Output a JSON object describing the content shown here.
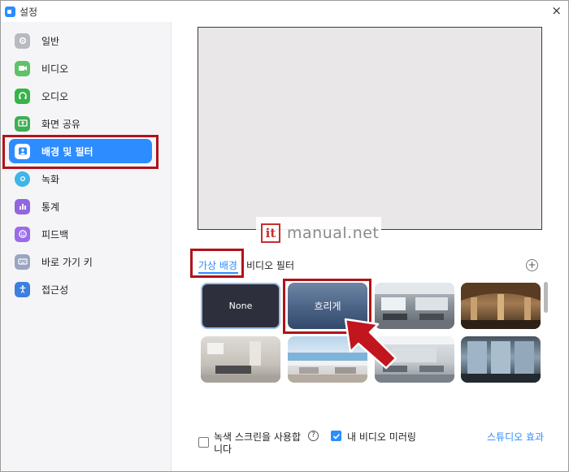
{
  "window": {
    "title": "설정",
    "close_symbol": "×"
  },
  "sidebar": {
    "items": [
      {
        "label": "일반",
        "icon": "gear-icon",
        "color": "#b9b9c3"
      },
      {
        "label": "비디오",
        "icon": "video-camera-icon",
        "color": "#5fc269"
      },
      {
        "label": "오디오",
        "icon": "headphones-icon",
        "color": "#37b34a"
      },
      {
        "label": "화면 공유",
        "icon": "screen-share-icon",
        "color": "#3fae55"
      },
      {
        "label": "배경 및 필터",
        "icon": "background-person-icon",
        "color": "#2d8cff",
        "active": true
      },
      {
        "label": "녹화",
        "icon": "record-icon",
        "color": "#3fb5e8"
      },
      {
        "label": "통계",
        "icon": "statistics-icon",
        "color": "#9166e0"
      },
      {
        "label": "피드백",
        "icon": "feedback-smile-icon",
        "color": "#9b6be8"
      },
      {
        "label": "바로 가기 키",
        "icon": "keyboard-icon",
        "color": "#9aa6c0"
      },
      {
        "label": "접근성",
        "icon": "accessibility-icon",
        "color": "#3d7fdd"
      }
    ]
  },
  "watermark": {
    "logo": "it",
    "text": "manual.net"
  },
  "tabs": {
    "virtual": "가상 배경",
    "filter": "비디오 필터",
    "add_symbol": "+"
  },
  "thumbnails": {
    "none_label": "None",
    "blur_label": "흐리게"
  },
  "options": {
    "green_screen_line1": "녹색 스크린을 사용합",
    "green_screen_line2": "니다",
    "help_symbol": "?",
    "mirror_label": "내 비디오 미러링",
    "studio_link": "스튜디오 효과"
  },
  "colors": {
    "accent": "#2d8cff",
    "highlight": "#b1121a",
    "arrow": "#c1161e"
  }
}
